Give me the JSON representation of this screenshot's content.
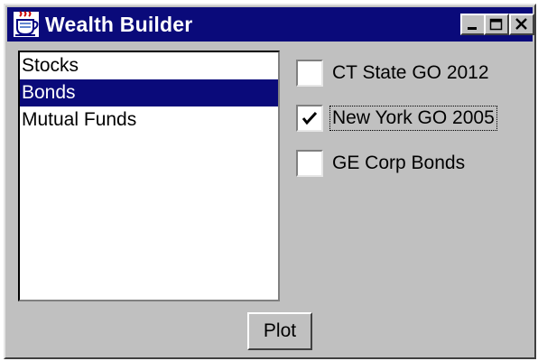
{
  "window": {
    "title": "Wealth Builder",
    "icon": "java-coffee-cup-icon",
    "controls": [
      "minimize-icon",
      "maximize-icon",
      "close-icon"
    ]
  },
  "list": {
    "items": [
      {
        "label": "Stocks",
        "selected": false
      },
      {
        "label": "Bonds",
        "selected": true
      },
      {
        "label": "Mutual Funds",
        "selected": false
      }
    ]
  },
  "checkboxes": [
    {
      "label": "CT State GO 2012",
      "checked": false
    },
    {
      "label": "New York GO 2005",
      "checked": true
    },
    {
      "label": "GE Corp Bonds",
      "checked": false
    }
  ],
  "buttons": {
    "plot": "Plot"
  },
  "colors": {
    "titlebar": "#0a0a7a",
    "selection": "#0a0a7a",
    "face": "#c0c0c0"
  }
}
